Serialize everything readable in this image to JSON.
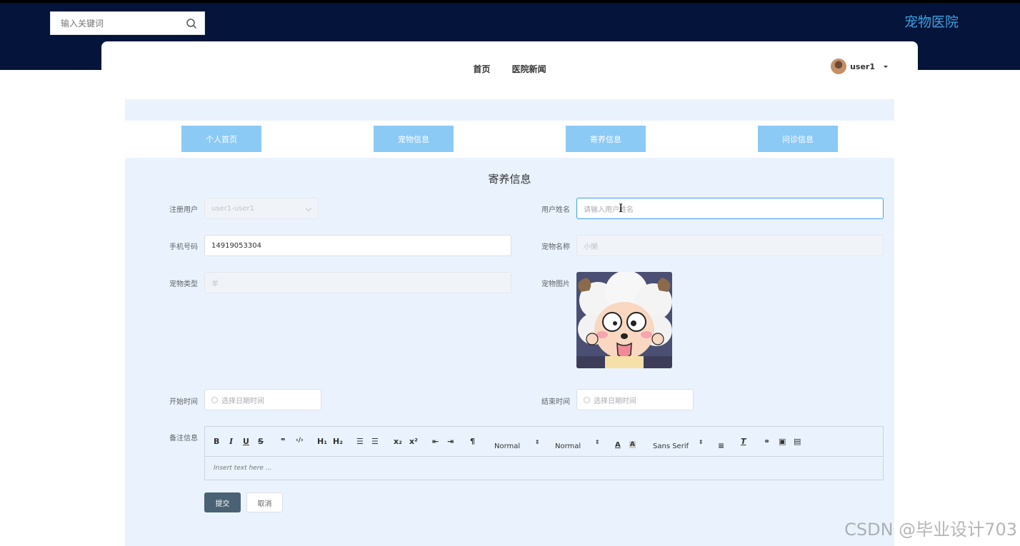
{
  "header": {
    "search_placeholder": "输入关键词",
    "brand": "宠物医院"
  },
  "nav": {
    "items": [
      "首页",
      "医院新闻"
    ],
    "username": "user1"
  },
  "tabs": [
    "个人首页",
    "宠物信息",
    "寄养信息",
    "问诊信息"
  ],
  "form": {
    "title": "寄养信息",
    "registered_user_label": "注册用户",
    "registered_user_value": "user1-user1",
    "user_name_label": "用户姓名",
    "user_name_placeholder": "请输入用户姓名",
    "phone_label": "手机号码",
    "phone_value": "14919053304",
    "pet_name_label": "宠物名称",
    "pet_name_value": "小懒",
    "pet_type_label": "宠物类型",
    "pet_type_value": "羊",
    "pet_image_label": "宠物图片",
    "start_time_label": "开始时间",
    "start_time_placeholder": "选择日期时间",
    "end_time_label": "结束时间",
    "end_time_placeholder": "选择日期时间",
    "notes_label": "备注信息",
    "notes_placeholder": "Insert text here ...",
    "toolbar": {
      "header_select": "Normal",
      "size_select": "Normal",
      "font_select": "Sans Serif"
    },
    "submit_label": "提交",
    "cancel_label": "取消"
  },
  "watermark": "CSDN @毕业设计703",
  "colors": {
    "topbar": "#05143a",
    "brand": "#3aa2e0",
    "tab_button": "#8ccaf6",
    "panel": "#eaf3fd",
    "submit": "#4a6273"
  }
}
